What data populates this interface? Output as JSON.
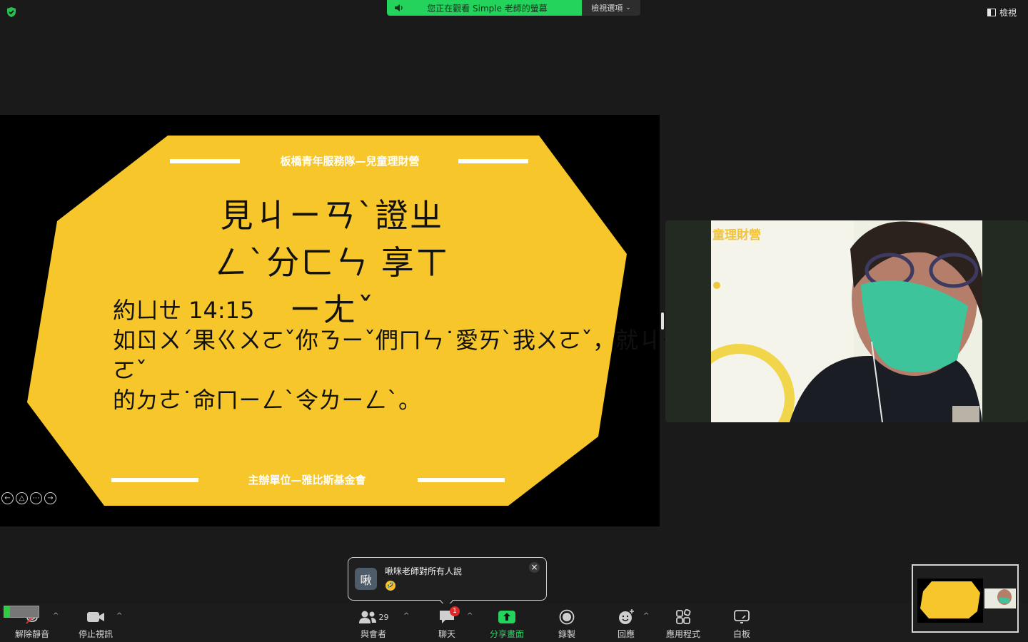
{
  "banner": {
    "text": "您正在觀看 Simple 老師的螢幕",
    "options": "檢視選項"
  },
  "top_right": {
    "view": "檢視"
  },
  "slide": {
    "header": "板橋青年服務隊—兒童理財營",
    "title": "見ㄐㄧㄢˋ證ㄓㄥˋ分ㄈㄣ 享ㄒㄧㄤˇ",
    "verse_ref": "約ㄩㄝ 14:15",
    "verse_line1": "如ㄖㄨˊ果ㄍㄨㄛˇ你ㄋㄧˇ們ㄇㄣ˙愛ㄞˋ我ㄨㄛˇ，就ㄐㄧㄡˋ要ㄧㄠˋ遵ㄗㄨㄣ守ㄕㄡˇ我ㄨㄛˇ",
    "verse_line2": "的ㄉㄜ˙命ㄇㄧㄥˋ令ㄌㄧㄥˋ。",
    "footer": "主辦單位—雅比斯基金會",
    "bg_color": "#f6c62b"
  },
  "video": {
    "caption": "童理財營"
  },
  "chat": {
    "avatar": "啾",
    "sender": "啾咪老師對所有人說",
    "emoji": "🤣"
  },
  "toolbar": {
    "unmute": "解除靜音",
    "stop_video": "停止視訊",
    "participants": "與會者",
    "participant_count": "29",
    "chat": "聊天",
    "chat_badge": "1",
    "share": "分享畫面",
    "record": "錄製",
    "reactions": "回應",
    "apps": "應用程式",
    "whiteboard": "白板"
  },
  "colors": {
    "share_green": "#23d35b",
    "slide_yellow": "#f6c62b"
  }
}
